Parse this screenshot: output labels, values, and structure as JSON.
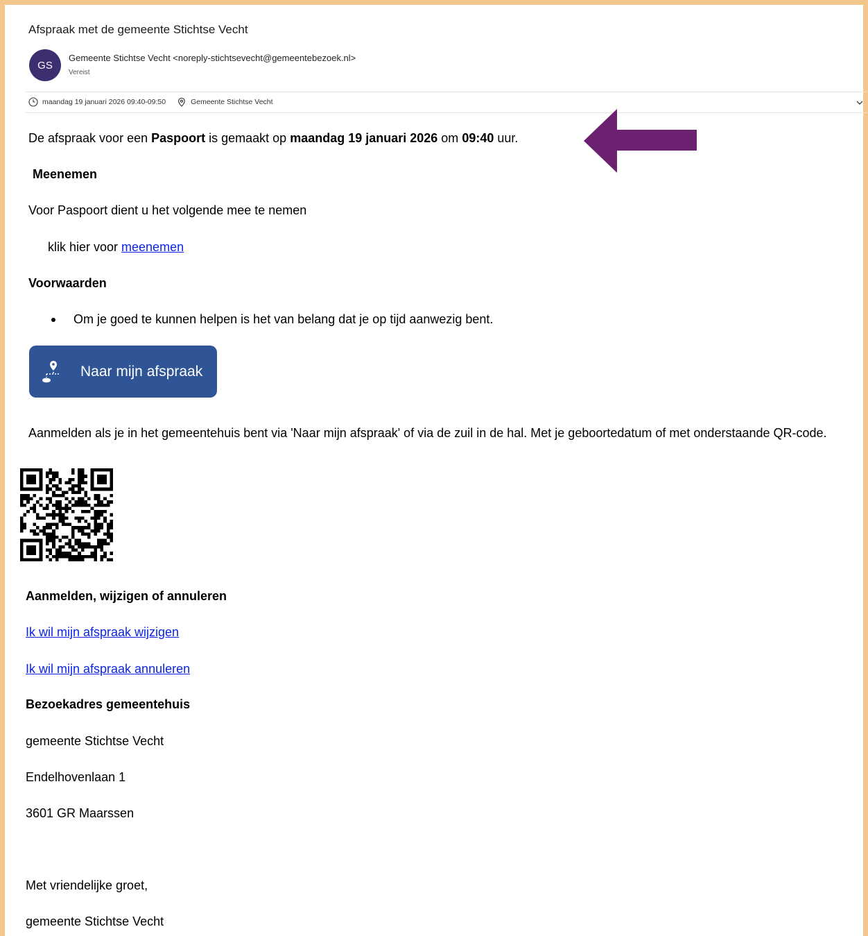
{
  "email": {
    "subject": "Afspraak met de gemeente Stichtse Vecht",
    "avatar_initials": "GS",
    "avatar_color": "#3d2f6f",
    "sender": "Gemeente Stichtse Vecht <noreply-stichtsevecht@gemeentebezoek.nl>",
    "attendance": "Vereist",
    "meeting_time": "maandag 19 januari 2026 09:40-09:50",
    "meeting_location": "Gemeente Stichtse Vecht"
  },
  "body": {
    "intro": {
      "p1": "De afspraak voor een ",
      "product": "Paspoort",
      "p2": " is gemaakt op ",
      "date": "maandag 19 januari 2026",
      "p3": " om ",
      "time": "09:40",
      "p4": " uur."
    },
    "meenemen_heading": "Meenemen",
    "meenemen_text": "Voor Paspoort dient u het volgende mee te nemen",
    "klik_prefix": "klik hier voor ",
    "klik_link": "meenemen",
    "voorwaarden_heading": "Voorwaarden",
    "voorwaarden_items": [
      "Om je goed te kunnen helpen is het van belang dat je op tijd aanwezig bent."
    ],
    "appointment_button": "Naar mijn afspraak",
    "button_color": "#2f5597",
    "aanmelden_text": "Aanmelden als je in het gemeentehuis bent via 'Naar mijn afspraak' of via de zuil in de hal.  Met je geboortedatum of met onderstaande QR-code.",
    "manage_heading": "Aanmelden, wijzigen of annuleren",
    "link_wijzigen": "Ik wil mijn afspraak wijzigen",
    "link_annuleren": "Ik wil mijn afspraak annuleren",
    "address_heading": "Bezoekadres gemeentehuis",
    "address_lines": [
      "gemeente Stichtse Vecht",
      "Endelhovenlaan 1",
      "3601 GR Maarssen"
    ],
    "closing": "Met vriendelijke groet,",
    "signature": "gemeente Stichtse Vecht"
  },
  "annotation": {
    "arrow_color": "#6b2170"
  },
  "frame_color": "#f3c68b",
  "link_color": "#0b24e6"
}
